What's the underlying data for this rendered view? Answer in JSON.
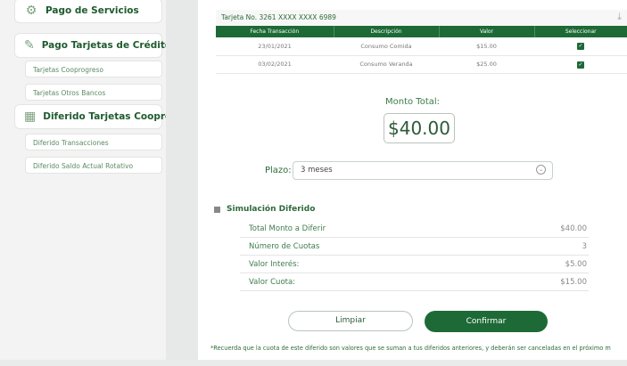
{
  "sidebar": {
    "sections": [
      {
        "label": "Pago de Servicios",
        "icon": "services-icon"
      },
      {
        "label": "Pago Tarjetas de Crédito",
        "icon": "credit-card-icon"
      },
      {
        "label": "Diferido Tarjetas Cooprogreso",
        "icon": "deferred-icon"
      }
    ],
    "sub_items": [
      "Tarjetas Cooprogreso",
      "Tarjetas Otros Bancos",
      "Diferido Transacciones",
      "Diferido Saldo Actual Rotativo"
    ]
  },
  "card": {
    "header": "Tarjeta No. 3261 XXXX XXXX 6989",
    "columns": [
      "Fecha Transacción",
      "Descripción",
      "Valor",
      "Seleccionar"
    ],
    "rows": [
      {
        "date": "23/01/2021",
        "description": "Consumo Comida",
        "value": "$15.00",
        "selected": true
      },
      {
        "date": "03/02/2021",
        "description": "Consumo Veranda",
        "value": "$25.00",
        "selected": true
      }
    ]
  },
  "monto": {
    "label": "Monto Total:",
    "value": "$40.00"
  },
  "plazo": {
    "label": "Plazo:",
    "value": "3 meses"
  },
  "simulacion": {
    "title": "Simulación Diferido",
    "rows": [
      {
        "label": "Total Monto a Diferir",
        "value": "$40.00"
      },
      {
        "label": "Número de Cuotas",
        "value": "3"
      },
      {
        "label": "Valor Interés:",
        "value": "$5.00"
      },
      {
        "label": "Valor Cuota:",
        "value": "$15.00"
      }
    ]
  },
  "buttons": {
    "limpiar": "Limpiar",
    "confirmar": "Confirmar"
  },
  "note": "*Recuerda que la cuota de este diferido son valores que se suman a tus diferidos anteriores, y deberán ser canceladas en el próximo m",
  "colors": {
    "brand_green": "#1d6a36",
    "accent_light": "#7ba17f"
  }
}
